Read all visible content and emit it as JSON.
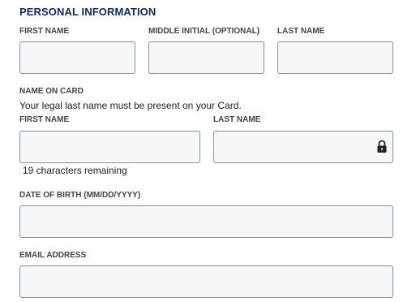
{
  "section": {
    "title": "PERSONAL INFORMATION"
  },
  "name_row": {
    "first_name_label": "FIRST NAME",
    "middle_initial_label": "MIDDLE INITIAL (OPTIONAL)",
    "last_name_label": "LAST NAME",
    "first_name_value": "",
    "middle_initial_value": "",
    "last_name_value": ""
  },
  "name_on_card": {
    "heading": "NAME ON CARD",
    "helper_text": "Your legal last name must be present on your Card.",
    "first_name_label": "FIRST NAME",
    "last_name_label": "LAST NAME",
    "first_name_value": "",
    "last_name_value": "",
    "last_name_locked": true,
    "lock_icon": "lock-icon",
    "characters_remaining": "19 characters remaining"
  },
  "date_of_birth": {
    "label": "DATE OF BIRTH (MM/DD/YYYY)",
    "value": ""
  },
  "email": {
    "label": "EMAIL ADDRESS",
    "value": ""
  },
  "colors": {
    "section_title": "#0c2b66",
    "field_background": "#f6f7f9",
    "field_border": "#8b8f96"
  }
}
